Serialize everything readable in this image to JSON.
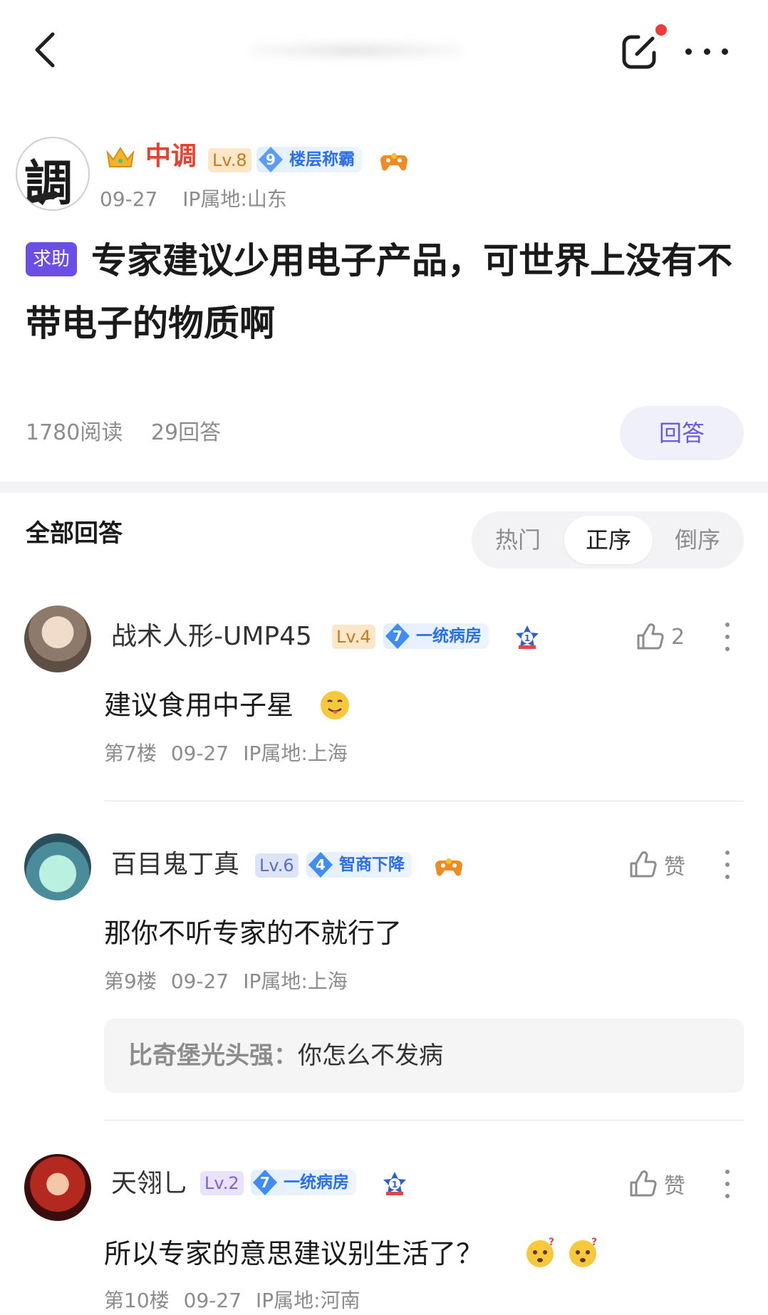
{
  "post": {
    "author": {
      "name": "中调",
      "level": "Lv.8",
      "badge_num": "9",
      "badge_text": "楼层称霸",
      "avatar_glyph": "調"
    },
    "date": "09-27",
    "ip": "IP属地:山东",
    "tag": "求助",
    "title": "专家建议少用电子产品，可世界上没有不带电子的物质啊",
    "reads": "1780阅读",
    "answers": "29回答",
    "answer_button": "回答"
  },
  "answers_section": {
    "title": "全部回答",
    "sort_options": [
      "热门",
      "正序",
      "倒序"
    ],
    "selected_sort": "正序"
  },
  "replies": [
    {
      "name": "战术人形-UMP45",
      "level": "Lv.4",
      "badge_num": "7",
      "badge_text": "一统病房",
      "content": "建议食用中子星",
      "floor": "第7楼",
      "date": "09-27",
      "ip": "IP属地:上海",
      "likes": "2"
    },
    {
      "name": "百目鬼丁真",
      "level": "Lv.6",
      "badge_num": "4",
      "badge_text": "智商下降",
      "content": "那你不听专家的不就行了",
      "floor": "第9楼",
      "date": "09-27",
      "ip": "IP属地:上海",
      "likes": "赞",
      "sub_reply": {
        "name": "比奇堡光头强：",
        "text": "你怎么不发病"
      }
    },
    {
      "name": "天翎乚",
      "level": "Lv.2",
      "badge_num": "7",
      "badge_text": "一统病房",
      "content": "所以专家的意思建议别生活了？",
      "floor": "第10楼",
      "date": "09-27",
      "ip": "IP属地:河南",
      "likes": "赞"
    }
  ],
  "colors": {
    "accent": "#6a5ae0",
    "author_name": "#e8412f",
    "badge_blue": "#2a6ee8",
    "meta_gray": "#8c8c8c"
  },
  "icons": [
    "back-arrow-icon",
    "edit-icon",
    "more-icon",
    "crown-icon",
    "gamepad-icon",
    "medal-icon",
    "thumbs-up-icon",
    "kebab-icon",
    "emoji-tongue-icon",
    "emoji-question-icon"
  ]
}
